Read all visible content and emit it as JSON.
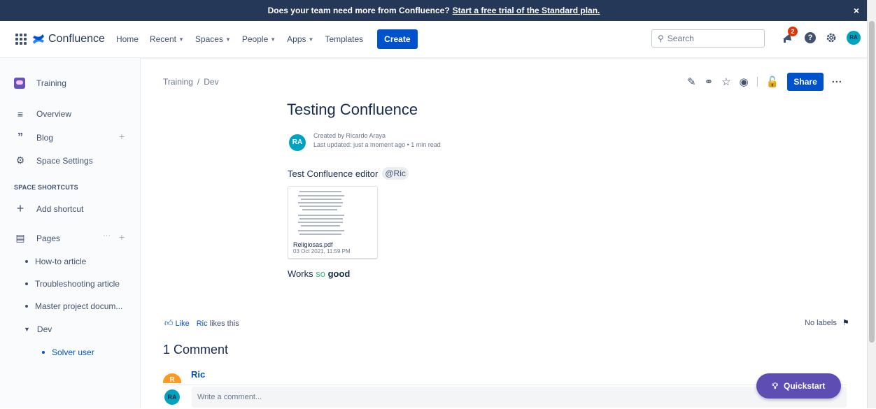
{
  "banner": {
    "text": "Does your team need more from Confluence?",
    "link": "Start a free trial of the Standard plan.",
    "close": "×"
  },
  "nav": {
    "logo": "Confluence",
    "items": [
      {
        "label": "Home"
      },
      {
        "label": "Recent",
        "chevron": true
      },
      {
        "label": "Spaces",
        "chevron": true
      },
      {
        "label": "People",
        "chevron": true
      },
      {
        "label": "Apps",
        "chevron": true
      },
      {
        "label": "Templates"
      }
    ],
    "create": "Create",
    "search_placeholder": "Search",
    "notification_count": "2",
    "help": "?",
    "avatar": "RA"
  },
  "sidebar": {
    "space_name": "Training",
    "overview": "Overview",
    "blog": "Blog",
    "space_settings": "Space Settings",
    "shortcuts_heading": "SPACE SHORTCUTS",
    "add_shortcut": "Add shortcut",
    "pages": "Pages",
    "page_items": [
      "How-to article",
      "Troubleshooting article",
      "Master project docum..."
    ],
    "dev": "Dev",
    "dev_child": "Solver user"
  },
  "breadcrumb": {
    "space": "Training",
    "sep": "/",
    "page": "Dev"
  },
  "page": {
    "share": "Share",
    "title": "Testing Confluence",
    "avatar": "RA",
    "created_by": "Created by Ricardo Araya",
    "last_updated": "Last updated: just a moment ago • 1 min read",
    "body_text": "Test Confluence editor",
    "mention": "@Ric",
    "attachment_name": "Religiosas.pdf",
    "attachment_date": "03 Oct 2021, 11:59 PM",
    "works_1": "Works ",
    "works_2": "so",
    "works_3": "good"
  },
  "footer": {
    "like": "Like",
    "liker": "Ric",
    "likes_this": "likes this",
    "no_labels": "No labels",
    "comment_count": "1 Comment",
    "commenter_initial": "R",
    "commenter": "Ric",
    "my_avatar": "RA",
    "comment_placeholder": "Write a comment...",
    "quickstart": "Quickstart"
  },
  "colors": {
    "brand_blue": "#0052cc",
    "banner": "#253858",
    "quickstart": "#5e4db2",
    "avatar": "#00a3bf",
    "notification": "#de350b"
  }
}
